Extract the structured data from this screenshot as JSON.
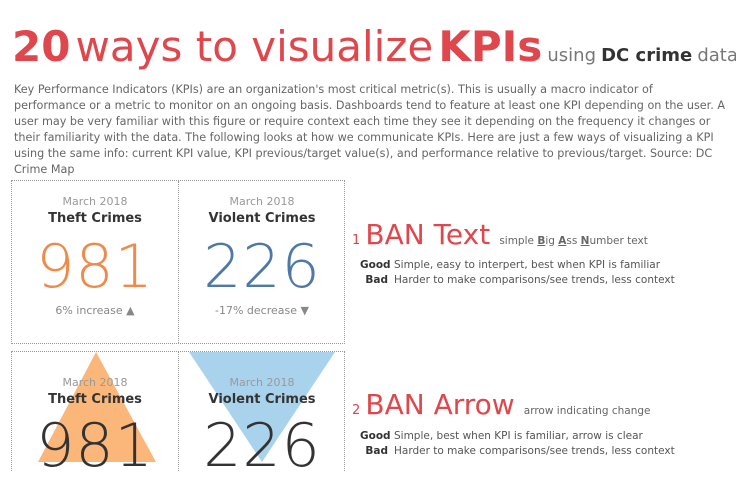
{
  "title": {
    "num": "20",
    "ways": "ways to visualize",
    "kpis": "KPIs",
    "using": "using",
    "dc": "DC crime",
    "data": "data"
  },
  "intro": "Key Performance Indicators (KPIs) are an organization's most critical metric(s). This is usually a macro indicator of performance or a metric to monitor on an ongoing basis. Dashboards tend to feature at least one KPI depending on the user. A user may be very familiar with this figure or require context each time they see it depending on the frequency it changes or their familiarity with the data.  The following looks at how we communicate KPIs. Here are just a few ways of visualizing a KPI using the same info: current KPI value, KPI previous/target value(s), and performance relative to previous/target. Source: DC Crime Map",
  "cards": {
    "theft": {
      "date": "March 2018",
      "metric": "Theft Crimes",
      "value": "981",
      "change": "6% increase ▲",
      "color": "#ef8a4b"
    },
    "violent": {
      "date": "March 2018",
      "metric": "Violent Crimes",
      "value": "226",
      "change": "-17% decrease ▼",
      "color": "#4e79a7"
    }
  },
  "sections": [
    {
      "index": "1",
      "name": "BAN Text",
      "sub_pre": "simple ",
      "sub_b": "B",
      "sub_1": "ig ",
      "sub_a": "A",
      "sub_2": "ss ",
      "sub_n": "N",
      "sub_3": "umber text",
      "good_label": "Good",
      "good": "Simple, easy to interpert, best when KPI is familiar",
      "bad_label": "Bad",
      "bad": "Harder to make comparisons/see trends, less context"
    },
    {
      "index": "2",
      "name": "BAN Arrow",
      "sub": "arrow indicating change",
      "good_label": "Good",
      "good": "Simple, best when KPI is familiar, arrow is clear",
      "bad_label": "Bad",
      "bad": "Harder to make comparisons/see trends, less context"
    }
  ],
  "colors": {
    "accent": "#e0474c",
    "theft": "#ef8a4b",
    "violent": "#4e79a7",
    "arrow_up": "#fbb77a",
    "arrow_down": "#a9d3ec"
  }
}
